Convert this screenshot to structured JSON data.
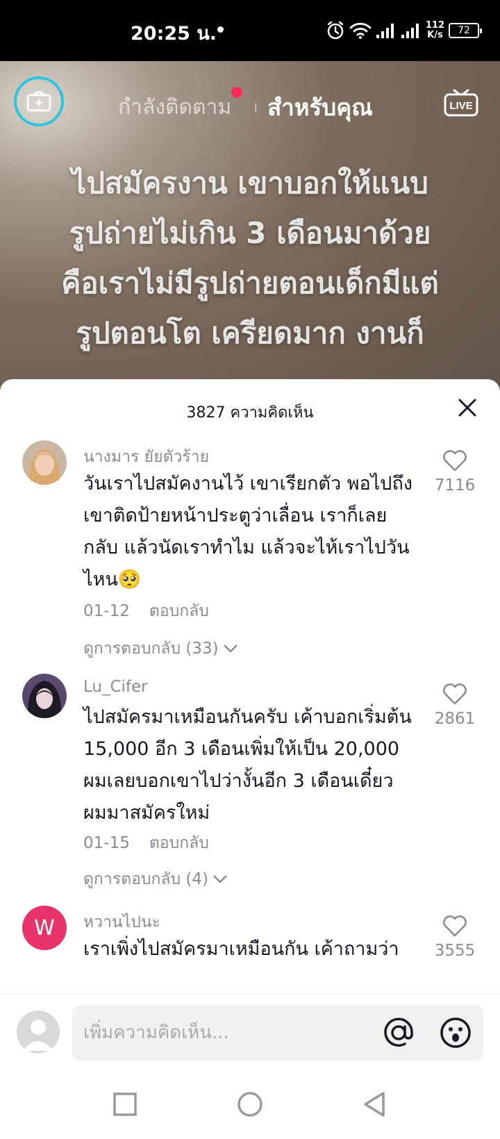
{
  "status_bar": {
    "time": "20:25 น.",
    "speed_value": "112",
    "speed_unit": "K/s",
    "battery": "72"
  },
  "top_nav": {
    "following": "กำลังติดตาม",
    "for_you": "สำหรับคุณ",
    "live_icon": "live-icon"
  },
  "video": {
    "caption_lines": [
      "ไปสมัครงาน เขาบอกให้แนบ",
      "รูปถ่ายไม่เกิน 3 เดือนมาด้วย",
      "คือเราไม่มีรูปถ่ายตอนเด็กมีแต่",
      "รูปตอนโต เครียดมาก งานก็"
    ]
  },
  "comments_panel": {
    "count_label": "3827 ความคิดเห็น",
    "comments": [
      {
        "username": "นางมาร ยัยตัวร้าย",
        "text": "วันเราไปสมัคงานไว้ เขาเรียกตัว พอไปถึง เขาติดป้ายหน้าประตูว่าเลื่อน เราก็เลยกลับ แล้วนัดเราทำไม แล้วจะไห้เราไปวันไหน🥺",
        "date": "01-12",
        "reply": "ตอบกลับ",
        "likes": "7116",
        "view_replies": "ดูการตอบกลับ (33)"
      },
      {
        "username": "Lu_Cifer",
        "text": "ไปสมัครมาเหมือนกันครับ เค้าบอกเริ่มต้น 15,000 อีก 3 เดือนเพิ่มให้เป็น 20,000 ผมเลยบอกเขาไปว่างั้นอีก 3 เดือนเดี๋ยวผมมาสมัครใหม่",
        "date": "01-15",
        "reply": "ตอบกลับ",
        "likes": "2861",
        "view_replies": "ดูการตอบกลับ (4)"
      },
      {
        "username": "หวานไปนะ",
        "avatar_letter": "W",
        "text": "เราเพิ่งไปสมัครมาเหมือนกัน เค้าถามว่า",
        "likes": "3555"
      }
    ]
  },
  "input": {
    "placeholder": "เพิ่มความคิดเห็น..."
  },
  "colors": {
    "accent_red": "#fe2c55",
    "camera_ring": "#2ec4e0",
    "avatar_pink": "#e8336b"
  }
}
